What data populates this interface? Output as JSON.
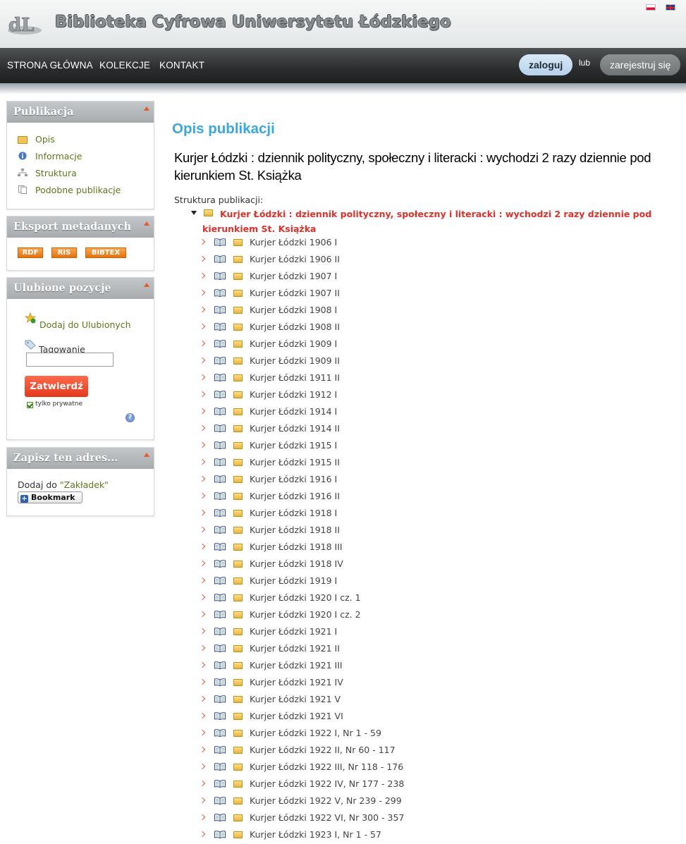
{
  "header": {
    "site_title": "Biblioteka Cyfrowa Uniwersytetu Łódzkiego",
    "lang_flags": [
      "pl-flag",
      "en-flag"
    ]
  },
  "nav": {
    "items": [
      "STRONA GŁÓWNA",
      "KOLEKCJE",
      "KONTAKT"
    ],
    "login": "zaloguj",
    "or": "lub",
    "register": "zarejestruj się"
  },
  "sidebar": {
    "publication": {
      "title": "Publikacja",
      "links": [
        "Opis",
        "Informacje",
        "Struktura",
        "Podobne publikacje"
      ]
    },
    "export": {
      "title": "Eksport metadanych",
      "buttons": [
        "RDF",
        "RIS",
        "BIBTEX"
      ]
    },
    "favorites": {
      "title": "Ulubione pozycje",
      "add": "Dodaj do Ulubionych",
      "tagging": "Tagowanie",
      "tag_value": "",
      "confirm": "Zatwierdź",
      "private_only": "tylko prywatne"
    },
    "save_address": {
      "title": "Zapisz ten adres...",
      "text_prefix": "Dodaj do ",
      "text_link": "\"Zakładek\"",
      "bookmark": "Bookmark"
    }
  },
  "main": {
    "heading": "Opis publikacji",
    "title": "Kurjer Łódzki : dziennik polityczny, społeczny i literacki : wychodzi 2 razy dziennie pod kierunkiem St. Książka",
    "structure_label": "Struktura publikacji:",
    "root": "Kurjer Łódzki : dziennik polityczny, społeczny i literacki : wychodzi 2 razy dziennie pod kierunkiem St. Książka",
    "tree_items": [
      "Kurjer Łódzki 1906 I",
      "Kurjer Łódzki 1906 II",
      "Kurjer Łódzki 1907 I",
      "Kurjer Łódzki 1907 II",
      "Kurjer Łódzki 1908 I",
      "Kurjer Łódzki 1908 II",
      "Kurjer Łódzki 1909 I",
      "Kurjer Łódzki 1909 II",
      "Kurjer Łódzki 1911 II",
      "Kurjer Łódzki 1912 I",
      "Kurjer Łódzki 1914 I",
      "Kurjer Łódzki 1914 II",
      "Kurjer Łódzki 1915 I",
      "Kurjer Łódzki 1915 II",
      "Kurjer Łódzki 1916 I",
      "Kurjer Łódzki 1916 II",
      "Kurjer Łódzki 1918 I",
      "Kurjer Łódzki 1918 II",
      "Kurjer Łódzki 1918 III",
      "Kurjer Łódzki 1918 IV",
      "Kurjer Łódzki 1919 I",
      "Kurjer Łódzki 1920 I cz. 1",
      "Kurjer Łódzki 1920 I cz. 2",
      "Kurjer Łódzki 1921 I",
      "Kurjer Łódzki 1921 II",
      "Kurjer Łódzki 1921 III",
      "Kurjer Łódzki 1921 IV",
      "Kurjer Łódzki 1921 V",
      "Kurjer Łódzki 1921 VI",
      "Kurjer Łódzki 1922 I, Nr 1 - 59",
      "Kurjer Łódzki 1922 II, Nr 60 - 117",
      "Kurjer Łódzki 1922 III, Nr 118 - 176",
      "Kurjer Łódzki 1922 IV, Nr 177 - 238",
      "Kurjer Łódzki 1922 V, Nr 239 - 299",
      "Kurjer Łódzki 1922 VI, Nr 300 - 357",
      "Kurjer Łódzki 1923 I, Nr 1 - 57"
    ]
  },
  "colors": {
    "heading_blue": "#3aa8dc",
    "root_red": "#e0302a",
    "link_green": "#5a7a1a",
    "accent_orange": "#e05a3a"
  }
}
